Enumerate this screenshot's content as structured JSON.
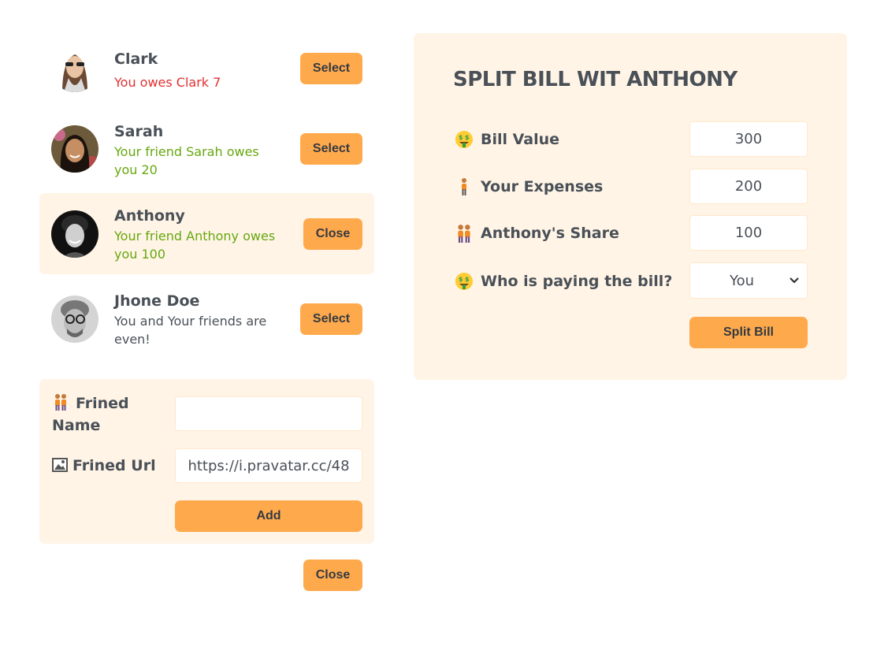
{
  "friends": [
    {
      "name": "Clark",
      "message": "You owes Clark 7",
      "button": "Select",
      "avatar_icon": "avatar-clark",
      "status": "owes-friend"
    },
    {
      "name": "Sarah",
      "message": "Your friend Sarah owes you 20",
      "button": "Select",
      "avatar_icon": "avatar-sarah",
      "status": "friend-owes"
    },
    {
      "name": "Anthony",
      "message": "Your friend Anthony owes you 100",
      "button": "Close",
      "avatar_icon": "avatar-anthony",
      "status": "friend-owes",
      "selected": true
    },
    {
      "name": "Jhone Doe",
      "message": "You and Your friends are even!",
      "button": "Select",
      "avatar_icon": "avatar-jhone",
      "status": "even"
    }
  ],
  "add_form": {
    "name_label": "Frined Name",
    "name_icon": "people-icon",
    "name_value": "",
    "url_label": "Frined Url",
    "url_icon": "picture-icon",
    "url_value": "https://i.pravatar.cc/48",
    "add_button": "Add"
  },
  "close_button": "Close",
  "split": {
    "title": "SPLIT BILL WIT ANTHONY",
    "bill_label": "Bill Value",
    "bill_icon": "money-face-icon",
    "bill_value": "300",
    "expense_label": "Your Expenses",
    "expense_icon": "person-icon",
    "expense_value": "200",
    "share_label": "Anthony's Share",
    "share_icon": "people-icon",
    "share_value": "100",
    "payer_label": "Who is paying the bill?",
    "payer_icon": "money-face-icon",
    "payer_value": "You",
    "split_button": "Split Bill"
  },
  "colors": {
    "accent": "#ffa94d",
    "panel": "#fff4e6",
    "red": "#e03131",
    "green": "#66a80f",
    "text": "#495057"
  }
}
